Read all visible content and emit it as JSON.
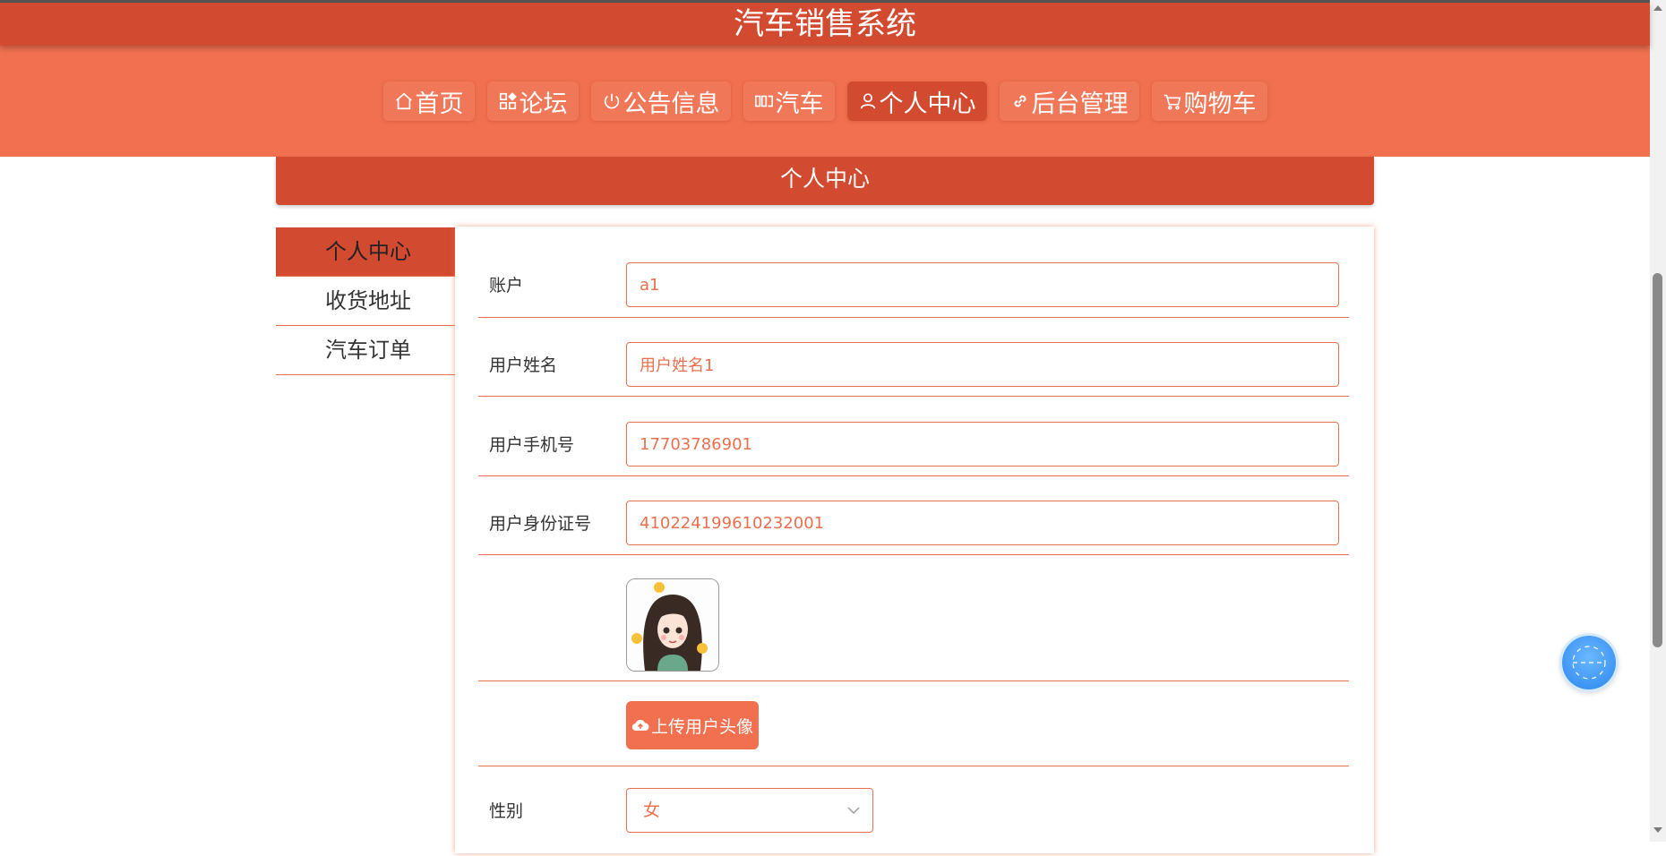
{
  "app": {
    "title": "汽车销售系统"
  },
  "nav": {
    "items": [
      {
        "label": "首页",
        "icon": "home-icon"
      },
      {
        "label": "论坛",
        "icon": "apps-icon"
      },
      {
        "label": "公告信息",
        "icon": "power-icon"
      },
      {
        "label": "汽车",
        "icon": "columns-icon"
      },
      {
        "label": "个人中心",
        "icon": "user-icon",
        "active": true
      },
      {
        "label": "后台管理",
        "icon": "link-icon"
      },
      {
        "label": "购物车",
        "icon": "cart-icon"
      }
    ]
  },
  "page": {
    "banner": "个人中心"
  },
  "sidebar": {
    "items": [
      {
        "label": "个人中心",
        "active": true
      },
      {
        "label": "收货地址"
      },
      {
        "label": "汽车订单"
      }
    ]
  },
  "form": {
    "account": {
      "label": "账户",
      "value": "a1"
    },
    "name": {
      "label": "用户姓名",
      "value": "用户姓名1"
    },
    "phone": {
      "label": "用户手机号",
      "value": "17703786901"
    },
    "idcard": {
      "label": "用户身份证号",
      "value": "410224199610232001"
    },
    "upload_label": "上传用户头像",
    "gender": {
      "label": "性别",
      "value": "女"
    }
  },
  "colors": {
    "primary": "#d24a30",
    "accent": "#f0704f",
    "input_text": "#e8704f",
    "float_button": "#2b86ee"
  }
}
